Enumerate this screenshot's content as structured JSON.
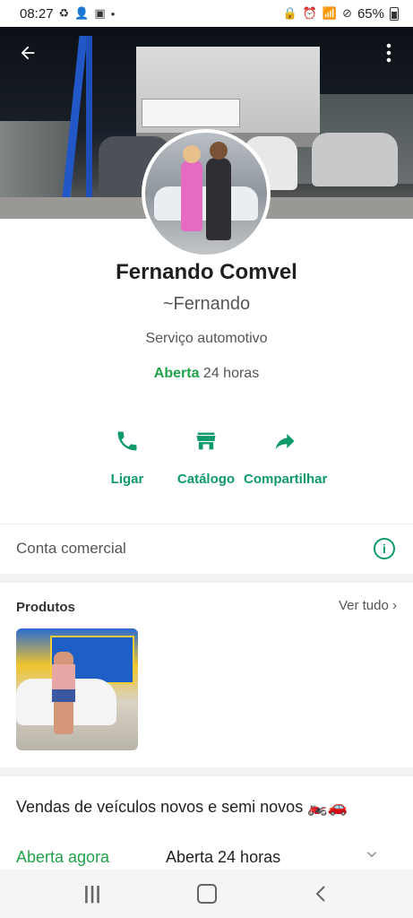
{
  "status_bar": {
    "time": "08:27",
    "battery": "65%"
  },
  "profile": {
    "name": "Fernando Comvel",
    "push_name": "~Fernando",
    "category": "Serviço automotivo",
    "hours_open_label": "Aberta",
    "hours_text": " 24 horas"
  },
  "actions": [
    {
      "label": "Ligar",
      "icon": "phone-icon"
    },
    {
      "label": "Catálogo",
      "icon": "store-icon"
    },
    {
      "label": "Compartilhar",
      "icon": "share-icon"
    }
  ],
  "business_account": {
    "label": "Conta comercial",
    "icon": "info-icon"
  },
  "products": {
    "title": "Produtos",
    "see_all": "Ver tudo"
  },
  "description": "Vendas de veículos novos e semi novos 🏍️🚗",
  "hours_row": {
    "status": "Aberta agora",
    "value": "Aberta 24 horas"
  },
  "colors": {
    "accent": "#0e9a6c",
    "open_green": "#21a14c"
  }
}
